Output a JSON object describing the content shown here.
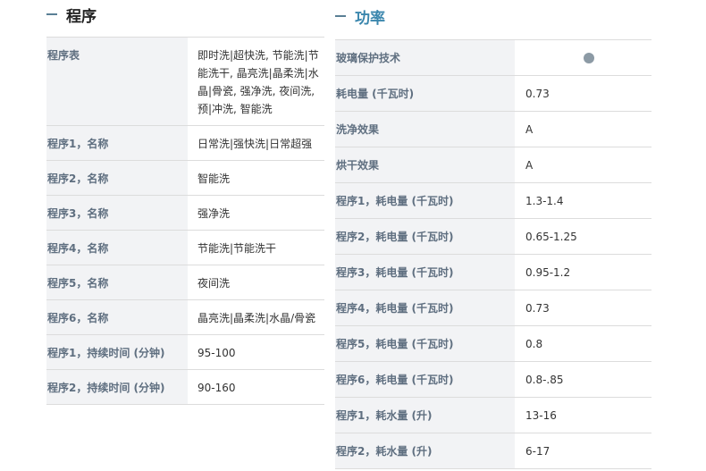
{
  "left": {
    "title": "程序",
    "rows": [
      {
        "label": "程序表",
        "value": "即时洗|超快洗, 节能洗|节能洗干, 晶亮洗|晶柔洗|水晶|骨瓷, 强净洗, 夜间洗, 预|冲洗, 智能洗"
      },
      {
        "label": "程序1，名称",
        "value": "日常洗|强快洗|日常超强"
      },
      {
        "label": "程序2，名称",
        "value": "智能洗"
      },
      {
        "label": "程序3，名称",
        "value": "强净洗"
      },
      {
        "label": "程序4，名称",
        "value": "节能洗|节能洗干"
      },
      {
        "label": "程序5，名称",
        "value": "夜间洗"
      },
      {
        "label": "程序6，名称",
        "value": "晶亮洗|晶柔洗|水晶/骨瓷"
      },
      {
        "label": "程序1，持续时间 (分钟)",
        "value": "95-100"
      },
      {
        "label": "程序2，持续时间 (分钟)",
        "value": "90-160"
      }
    ]
  },
  "right": {
    "title": "功率",
    "rows": [
      {
        "label": "玻璃保护技术",
        "value": "",
        "icon": "filled-dot-icon"
      },
      {
        "label": "耗电量 (千瓦时)",
        "value": "0.73"
      },
      {
        "label": "洗净效果",
        "value": "A"
      },
      {
        "label": "烘干效果",
        "value": "A"
      },
      {
        "label": "程序1，耗电量 (千瓦时)",
        "value": "1.3-1.4"
      },
      {
        "label": "程序2，耗电量 (千瓦时)",
        "value": "0.65-1.25"
      },
      {
        "label": "程序3，耗电量 (千瓦时)",
        "value": "0.95-1.2"
      },
      {
        "label": "程序4，耗电量 (千瓦时)",
        "value": "0.73"
      },
      {
        "label": "程序5，耗电量 (千瓦时)",
        "value": "0.8"
      },
      {
        "label": "程序6，耗电量 (千瓦时)",
        "value": "0.8-.85"
      },
      {
        "label": "程序1，耗水量 (升)",
        "value": "13-16"
      },
      {
        "label": "程序2，耗水量 (升)",
        "value": "6-17"
      }
    ]
  },
  "colors": {
    "accent": "#3a86ad",
    "label_bg": "#f2f3f5",
    "label_text": "#5f6f80",
    "border": "#dcdcdc"
  }
}
